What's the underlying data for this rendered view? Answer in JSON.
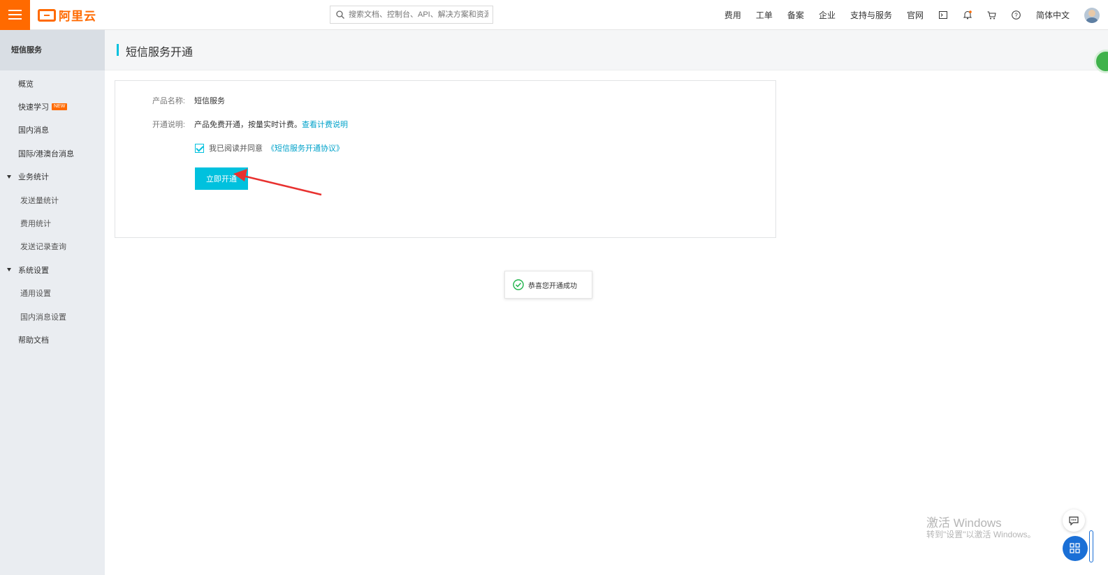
{
  "topbar": {
    "logo_text": "阿里云",
    "search_placeholder": "搜索文档、控制台、API、解决方案和资源",
    "nav": [
      "费用",
      "工单",
      "备案",
      "企业",
      "支持与服务",
      "官网"
    ],
    "language": "简体中文",
    "icons": [
      "terminal-icon",
      "bell-icon",
      "cart-icon",
      "help-icon"
    ],
    "accent_color": "#ff6a00"
  },
  "sidebar": {
    "title": "短信服务",
    "items": [
      {
        "label": "概览"
      },
      {
        "label": "快速学习",
        "badge": "NEW"
      },
      {
        "label": "国内消息"
      },
      {
        "label": "国际/港澳台消息"
      },
      {
        "label": "业务统计"
      },
      {
        "label": "发送量统计"
      },
      {
        "label": "费用统计"
      },
      {
        "label": "发送记录查询"
      },
      {
        "label": "系统设置"
      },
      {
        "label": "通用设置"
      },
      {
        "label": "国内消息设置"
      },
      {
        "label": "帮助文档"
      }
    ]
  },
  "page": {
    "title": "短信服务开通",
    "product_label": "产品名称:",
    "product_value": "短信服务",
    "desc_label": "开通说明:",
    "desc_value": "产品免费开通，按量实时计费。",
    "desc_link": "查看计费说明",
    "agree_text": "我已阅读并同意",
    "agree_link": "《短信服务开通协议》",
    "agree_checked": true,
    "open_button": "立即开通",
    "primary_color": "#00c1de"
  },
  "toast": {
    "message": "恭喜您开通成功"
  },
  "watermark": {
    "line1": "激活 Windows",
    "line2": "转到\"设置\"以激活 Windows。"
  }
}
